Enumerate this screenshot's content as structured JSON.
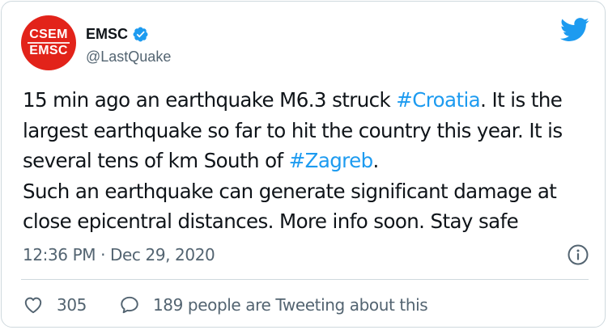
{
  "author": {
    "avatar_line1": "CSEM",
    "avatar_line2": "EMSC",
    "name": "EMSC",
    "handle": "@LastQuake",
    "verified": true
  },
  "tweet": {
    "segments": [
      {
        "text": "15 min ago an earthquake M6.3 struck ",
        "type": "text"
      },
      {
        "text": "#Croatia",
        "type": "hashtag"
      },
      {
        "text": ". It is the largest earthquake so far to hit the country this year. It is several tens of km South of ",
        "type": "text"
      },
      {
        "text": "#Zagreb",
        "type": "hashtag"
      },
      {
        "text": ".",
        "type": "text"
      },
      {
        "text": "Such an earthquake can generate significant damage at close epicentral distances. More info soon. Stay safe",
        "type": "text",
        "newline_before": true
      }
    ],
    "time": "12:36 PM",
    "separator": "·",
    "date": "Dec 29, 2020"
  },
  "actions": {
    "likes_count": "305",
    "conversation_text": "189 people are Tweeting about this"
  },
  "icons": {
    "brand": "twitter-bird-icon",
    "verified": "verified-badge-icon",
    "info": "info-icon",
    "like": "heart-icon",
    "reply": "speech-bubble-icon"
  },
  "colors": {
    "accent": "#1d9bf0",
    "text": "#0f1419",
    "secondary": "#536471",
    "avatar_bg": "#e2231a",
    "border": "#cfd9de"
  }
}
